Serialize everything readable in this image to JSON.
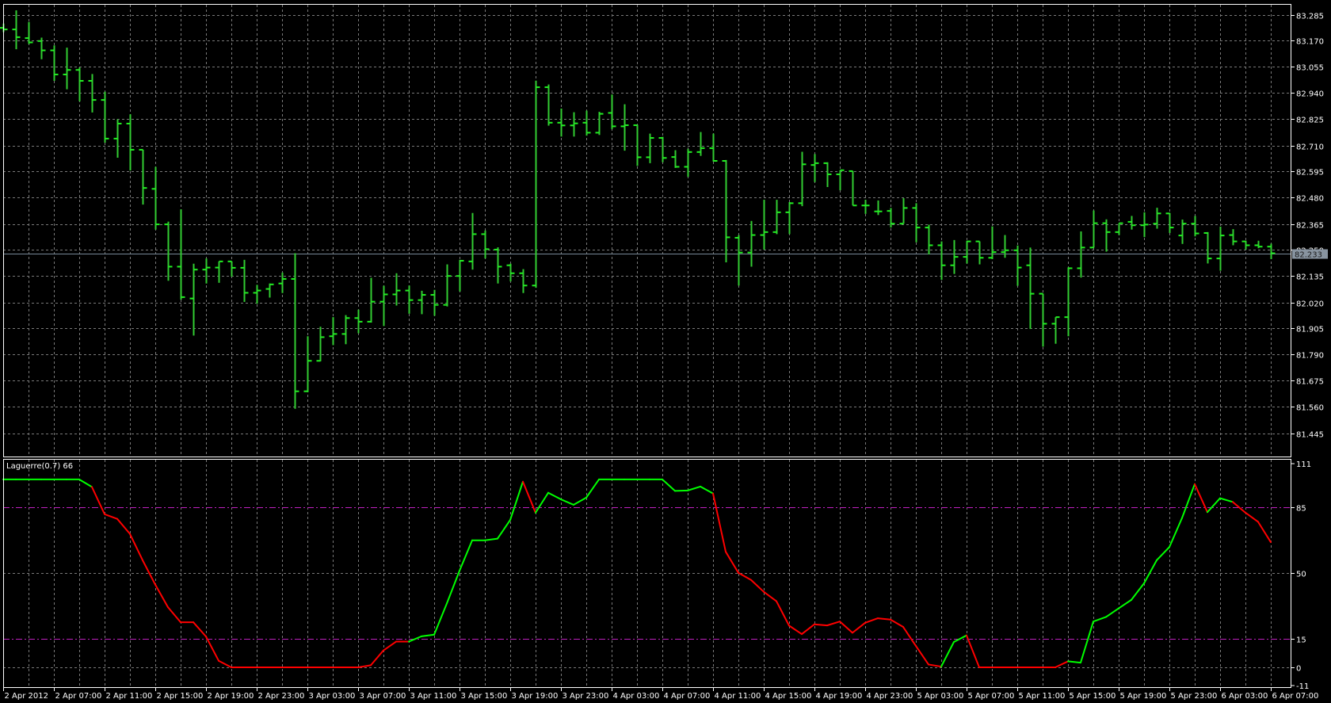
{
  "chart_data": {
    "type": "ohlc-bar",
    "timeframe_bars": "hourly",
    "price_axis": {
      "ticks": [
        "83.285",
        "83.170",
        "83.055",
        "82.940",
        "82.825",
        "82.710",
        "82.595",
        "82.480",
        "82.365",
        "82.250",
        "82.135",
        "82.020",
        "81.905",
        "81.790",
        "81.675",
        "81.560",
        "81.445"
      ],
      "range": [
        81.34,
        83.332
      ]
    },
    "current_price": "82.233",
    "x_labels": [
      "2 Apr 2012",
      "2 Apr 07:00",
      "2 Apr 11:00",
      "2 Apr 15:00",
      "2 Apr 19:00",
      "2 Apr 23:00",
      "3 Apr 03:00",
      "3 Apr 07:00",
      "3 Apr 11:00",
      "3 Apr 15:00",
      "3 Apr 19:00",
      "3 Apr 23:00",
      "4 Apr 03:00",
      "4 Apr 07:00",
      "4 Apr 11:00",
      "4 Apr 15:00",
      "4 Apr 19:00",
      "4 Apr 23:00",
      "5 Apr 03:00",
      "5 Apr 07:00",
      "5 Apr 11:00",
      "5 Apr 15:00",
      "5 Apr 19:00",
      "5 Apr 23:00",
      "6 Apr 03:00",
      "6 Apr 07:00"
    ],
    "ohlc": [
      [
        83.227,
        83.246,
        83.208,
        83.22
      ],
      [
        83.22,
        83.304,
        83.133,
        83.186
      ],
      [
        83.182,
        83.253,
        83.156,
        83.163
      ],
      [
        83.169,
        83.184,
        83.089,
        83.128
      ],
      [
        83.128,
        83.15,
        82.994,
        83.022
      ],
      [
        83.022,
        83.14,
        82.957,
        83.042
      ],
      [
        83.042,
        83.053,
        82.904,
        82.994
      ],
      [
        82.994,
        83.024,
        82.855,
        82.91
      ],
      [
        82.91,
        82.946,
        82.722,
        82.74
      ],
      [
        82.74,
        82.825,
        82.656,
        82.806
      ],
      [
        82.806,
        82.847,
        82.6,
        82.691
      ],
      [
        82.691,
        82.691,
        82.45,
        82.523
      ],
      [
        82.519,
        82.616,
        82.34,
        82.363
      ],
      [
        82.363,
        82.375,
        82.115,
        82.177
      ],
      [
        82.177,
        82.429,
        82.032,
        82.043
      ],
      [
        82.037,
        82.19,
        81.874,
        82.164
      ],
      [
        82.164,
        82.213,
        82.103,
        82.173
      ],
      [
        82.173,
        82.2,
        82.106,
        82.2
      ],
      [
        82.2,
        82.2,
        82.133,
        82.172
      ],
      [
        82.172,
        82.207,
        82.022,
        82.062
      ],
      [
        82.062,
        82.097,
        82.014,
        82.072
      ],
      [
        82.079,
        82.103,
        82.041,
        82.099
      ],
      [
        82.103,
        82.151,
        82.061,
        82.123
      ],
      [
        82.123,
        82.236,
        81.552,
        81.629
      ],
      [
        81.629,
        81.871,
        81.625,
        81.763
      ],
      [
        81.763,
        81.913,
        81.761,
        81.867
      ],
      [
        81.871,
        81.955,
        81.832,
        81.881
      ],
      [
        81.881,
        81.964,
        81.836,
        81.951
      ],
      [
        81.951,
        81.988,
        81.884,
        81.935
      ],
      [
        81.935,
        82.128,
        81.931,
        82.023
      ],
      [
        82.023,
        82.093,
        81.916,
        82.055
      ],
      [
        82.055,
        82.148,
        82.006,
        82.072
      ],
      [
        82.072,
        82.094,
        81.97,
        82.03
      ],
      [
        82.03,
        82.071,
        81.968,
        82.053
      ],
      [
        82.053,
        82.075,
        81.961,
        82.009
      ],
      [
        82.009,
        82.187,
        82.002,
        82.136
      ],
      [
        82.136,
        82.207,
        82.068,
        82.203
      ],
      [
        82.2,
        82.413,
        82.164,
        82.32
      ],
      [
        82.32,
        82.336,
        82.213,
        82.254
      ],
      [
        82.252,
        82.262,
        82.103,
        82.177
      ],
      [
        82.183,
        82.19,
        82.112,
        82.148
      ],
      [
        82.148,
        82.166,
        82.061,
        82.094
      ],
      [
        82.094,
        82.995,
        82.084,
        82.966
      ],
      [
        82.966,
        82.978,
        82.797,
        82.81
      ],
      [
        82.81,
        82.872,
        82.749,
        82.798
      ],
      [
        82.798,
        82.856,
        82.749,
        82.807
      ],
      [
        82.81,
        82.863,
        82.753,
        82.766
      ],
      [
        82.766,
        82.858,
        82.756,
        82.849
      ],
      [
        82.853,
        82.934,
        82.782,
        82.794
      ],
      [
        82.794,
        82.891,
        82.687,
        82.799
      ],
      [
        82.799,
        82.801,
        82.62,
        82.658
      ],
      [
        82.658,
        82.762,
        82.632,
        82.743
      ],
      [
        82.743,
        82.748,
        82.636,
        82.655
      ],
      [
        82.659,
        82.689,
        82.611,
        82.616
      ],
      [
        82.616,
        82.695,
        82.572,
        82.681
      ],
      [
        82.681,
        82.769,
        82.664,
        82.698
      ],
      [
        82.698,
        82.762,
        82.639,
        82.642
      ],
      [
        82.642,
        82.646,
        82.196,
        82.306
      ],
      [
        82.304,
        82.316,
        82.094,
        82.239
      ],
      [
        82.239,
        82.378,
        82.177,
        82.316
      ],
      [
        82.316,
        82.471,
        82.252,
        82.329
      ],
      [
        82.329,
        82.471,
        82.32,
        82.416
      ],
      [
        82.416,
        82.461,
        82.32,
        82.456
      ],
      [
        82.456,
        82.682,
        82.443,
        82.627
      ],
      [
        82.624,
        82.672,
        82.549,
        82.632
      ],
      [
        82.632,
        82.636,
        82.527,
        82.583
      ],
      [
        82.583,
        82.601,
        82.513,
        82.601
      ],
      [
        82.597,
        82.597,
        82.446,
        82.446
      ],
      [
        82.446,
        82.471,
        82.409,
        82.446
      ],
      [
        82.42,
        82.468,
        82.404,
        82.42
      ],
      [
        82.422,
        82.435,
        82.349,
        82.366
      ],
      [
        82.366,
        82.478,
        82.366,
        82.435
      ],
      [
        82.435,
        82.456,
        82.284,
        82.349
      ],
      [
        82.349,
        82.362,
        82.231,
        82.271
      ],
      [
        82.271,
        82.288,
        82.119,
        82.183
      ],
      [
        82.183,
        82.294,
        82.145,
        82.22
      ],
      [
        82.22,
        82.291,
        82.191,
        82.288
      ],
      [
        82.288,
        82.288,
        82.187,
        82.216
      ],
      [
        82.216,
        82.354,
        82.21,
        82.241
      ],
      [
        82.241,
        82.316,
        82.216,
        82.249
      ],
      [
        82.249,
        82.27,
        82.093,
        82.173
      ],
      [
        82.183,
        82.261,
        81.903,
        82.058
      ],
      [
        82.058,
        82.058,
        81.825,
        81.926
      ],
      [
        81.926,
        81.955,
        81.838,
        81.955
      ],
      [
        81.955,
        82.174,
        81.871,
        82.17
      ],
      [
        82.17,
        82.332,
        82.129,
        82.261
      ],
      [
        82.261,
        82.424,
        82.261,
        82.368
      ],
      [
        82.368,
        82.385,
        82.243,
        82.329
      ],
      [
        82.329,
        82.368,
        82.316,
        82.368
      ],
      [
        82.374,
        82.4,
        82.34,
        82.359
      ],
      [
        82.359,
        82.416,
        82.307,
        82.362
      ],
      [
        82.366,
        82.436,
        82.344,
        82.411
      ],
      [
        82.411,
        82.413,
        82.325,
        82.349
      ],
      [
        82.314,
        82.384,
        82.277,
        82.366
      ],
      [
        82.366,
        82.4,
        82.31,
        82.323
      ],
      [
        82.325,
        82.329,
        82.191,
        82.213
      ],
      [
        82.213,
        82.353,
        82.159,
        82.314
      ],
      [
        82.316,
        82.342,
        82.271,
        82.288
      ],
      [
        82.288,
        82.291,
        82.252,
        82.271
      ],
      [
        82.271,
        82.291,
        82.258,
        82.265
      ],
      [
        82.265,
        82.278,
        82.21,
        82.236
      ]
    ],
    "indicator": {
      "title": "Laguerre(0.7) 66",
      "axis_ticks": [
        "111",
        "85",
        "50",
        "15",
        "0",
        "-11"
      ],
      "range": [
        -11,
        111
      ],
      "levels": [
        85,
        15
      ],
      "values": [
        100,
        100,
        100,
        100,
        100,
        100,
        100,
        96,
        81.5,
        79,
        71,
        57,
        44,
        32,
        24,
        24,
        16.4,
        3.5,
        0,
        0,
        0,
        0,
        0,
        0,
        0,
        0,
        0,
        0,
        0,
        1.1,
        9,
        13.7,
        13.7,
        16.5,
        17.4,
        34,
        51.4,
        67.6,
        67.6,
        68.5,
        78.4,
        98.8,
        82.3,
        92.9,
        89.4,
        86.5,
        90.3,
        100,
        100,
        100,
        100,
        100,
        100,
        93.9,
        94.1,
        96.2,
        92.5,
        61.5,
        50.3,
        46.5,
        40.2,
        35.2,
        22.2,
        17.7,
        22.9,
        22.3,
        24.4,
        18.4,
        23.7,
        26.1,
        25.4,
        21.5,
        11.4,
        1.5,
        0.4,
        13.5,
        17,
        0,
        0,
        0,
        0,
        0,
        0,
        0,
        3.2,
        2.5,
        24.4,
        26.8,
        31.4,
        35.9,
        44.7,
        57,
        64,
        79.5,
        97.5,
        82.6,
        90,
        88,
        82.3,
        77.4,
        66.6
      ],
      "direction": "ggggggggrrrrrrrrrrrrrrrrrrrrrrrrrgggggggggrggggggggggggggrrrrrrrrrrrrrrrrrrggrrrrrrrrggggggggggrggrrr"
    },
    "colors": {
      "background": "#000000",
      "bar": "#32cd32",
      "bar_tick": "#22ee22",
      "grid": "#7a7a7a",
      "frame": "#ffffff",
      "level": "#c020c0",
      "up_line": "#00ff00",
      "down_line": "#ff0000",
      "price_line": "#778899"
    }
  }
}
